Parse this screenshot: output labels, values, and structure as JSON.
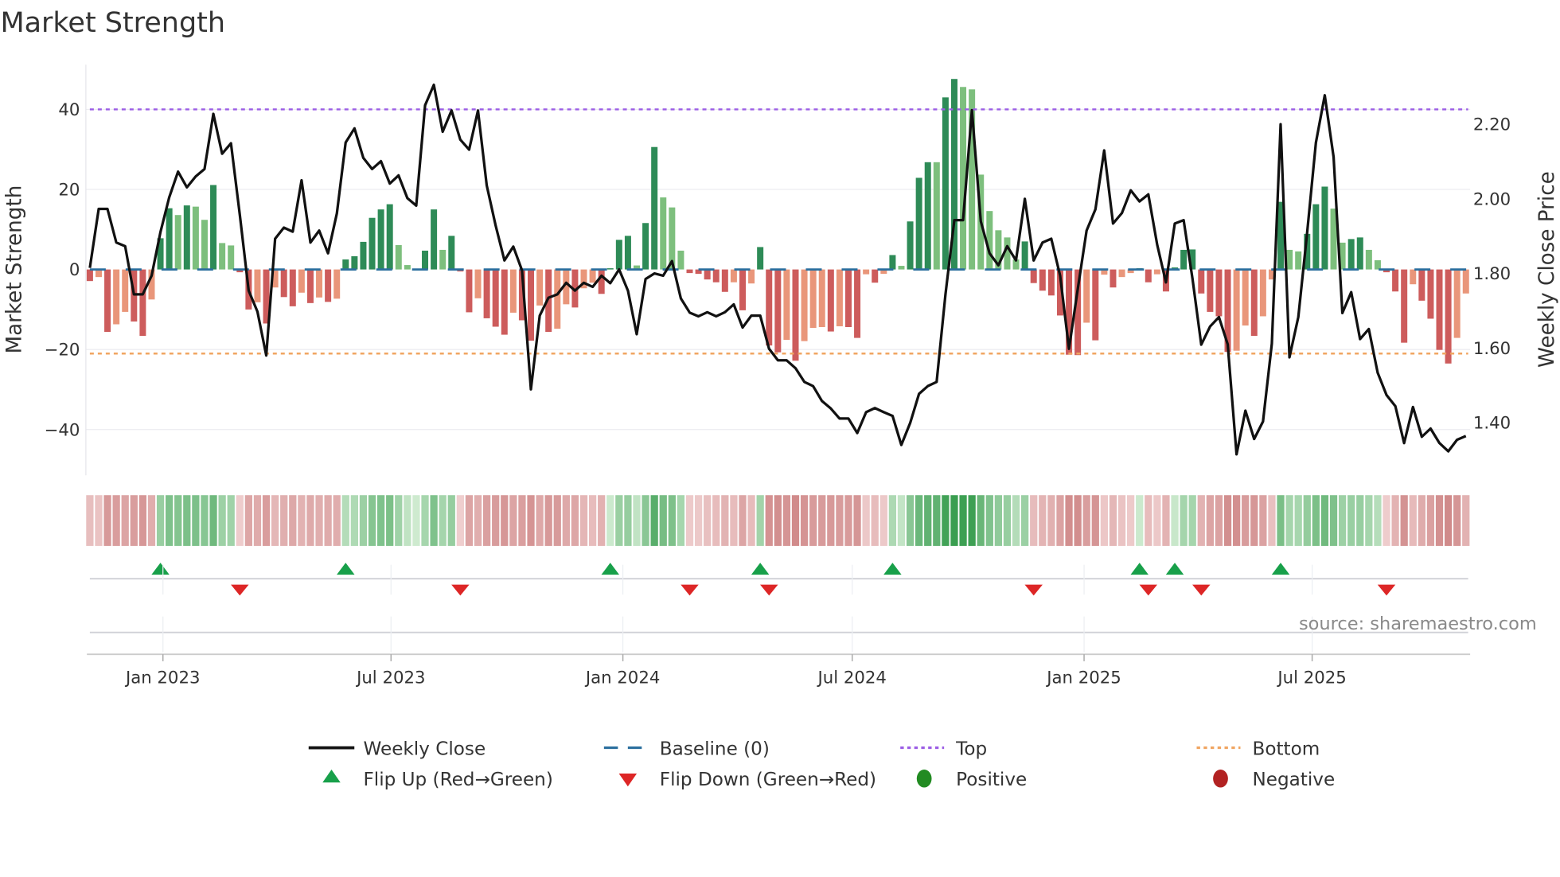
{
  "title": "Market Strength",
  "source": "source: sharemaestro.com",
  "colors": {
    "pos_strong": "#2e8b57",
    "pos_weak": "#7dbf7d",
    "neg_strong": "#cd5c5c",
    "neg_weak": "#e9967a",
    "close_line": "#111111",
    "baseline": "#2b6f9e",
    "top": "#9b5de5",
    "bottom": "#f0a561",
    "flip_up": "#18a04a",
    "flip_down": "#dd2626",
    "positive": "#228b22",
    "negative": "#b22222"
  },
  "legend": {
    "weekly_close": "Weekly Close",
    "baseline": "Baseline (0)",
    "top": "Top",
    "bottom": "Bottom",
    "flip_up": "Flip Up (Red→Green)",
    "flip_down": "Flip Down (Green→Red)",
    "positive": "Positive",
    "negative": "Negative"
  },
  "chart_data": {
    "type": "bar",
    "title": "Market Strength",
    "ylabel": "Market Strength",
    "y2label": "Weekly Close Price",
    "ylim": [
      -52,
      50
    ],
    "y2lim": [
      1.27,
      2.38
    ],
    "yticks": [
      40,
      20,
      0,
      -20,
      -40
    ],
    "ytick_labels": [
      "40",
      "20",
      "0",
      "−20",
      "−40"
    ],
    "y2ticks": [
      2.2,
      2.0,
      1.8,
      1.6,
      1.4
    ],
    "y2tick_labels": [
      "2.20",
      "2.00",
      "1.80",
      "1.60",
      "1.40"
    ],
    "top_level": 40,
    "bottom_level": -21,
    "baseline": 0,
    "x_start": "2022-11-04",
    "x_step_days": 7,
    "xticks": [
      "2023-01-01",
      "2023-07-01",
      "2024-01-01",
      "2024-07-01",
      "2025-01-01",
      "2025-07-01"
    ],
    "xtick_labels": [
      "Jan 2023",
      "Jul 2023",
      "Jan 2024",
      "Jul 2024",
      "Jan 2025",
      "Jul 2025"
    ],
    "grid": true,
    "legend_position": "bottom",
    "series": [
      {
        "name": "Market Strength",
        "type": "bar",
        "values": [
          -2.9,
          -1.9,
          -15.6,
          -13.7,
          -10.6,
          -13,
          -16.6,
          -7.5,
          7.8,
          15.3,
          13.6,
          16,
          15.7,
          12.4,
          21.1,
          6.6,
          6,
          -0.7,
          -10,
          -8.2,
          -13.5,
          -4.5,
          -6.9,
          -9.2,
          -5.8,
          -8.4,
          -7,
          -8.1,
          -7.3,
          2.5,
          3.3,
          6.9,
          12.9,
          15,
          16.3,
          6.1,
          1.1,
          0.2,
          4.7,
          15,
          4.9,
          8.4,
          -0.5,
          -10.7,
          -7.2,
          -12.2,
          -14.3,
          -16.3,
          -10.8,
          -12.7,
          -17.8,
          -9,
          -15.6,
          -14.8,
          -8.7,
          -9.5,
          -4.7,
          -3.3,
          -6.1,
          0.3,
          7.4,
          8.4,
          1,
          11.6,
          30.6,
          18,
          15.5,
          4.7,
          -0.9,
          -1.1,
          -2.5,
          -3.2,
          -5.6,
          -3.2,
          -10.2,
          -3.5,
          5.6,
          -19,
          -20.7,
          -17.6,
          -22.8,
          -17.9,
          -14.6,
          -14.4,
          -15.5,
          -14.2,
          -14.4,
          -17.1,
          -1.2,
          -3.3,
          -1.1,
          3.6,
          0.9,
          12,
          22.9,
          26.8,
          26.8,
          43,
          47.6,
          45.6,
          45,
          23.7,
          14.6,
          9.8,
          8,
          2.5,
          7,
          -3.4,
          -5.3,
          -6.5,
          -11.5,
          -21.3,
          -21.4,
          -13.3,
          -17.7,
          -1.3,
          -4.5,
          -1.9,
          -0.9,
          0.3,
          -3.2,
          -1.2,
          -5.5,
          0.5,
          4.9,
          5.0,
          -6,
          -10.6,
          -11.7,
          -20.6,
          -20.3,
          -14,
          -16.6,
          -11.7,
          -2.5,
          16.9,
          4.9,
          4.5,
          8.9,
          16.3,
          20.7,
          15.2,
          6.7,
          7.6,
          8,
          4.9,
          2.3,
          -0.7,
          -5.5,
          -18.3,
          -3.7,
          -7.8,
          -12.3,
          -20.1,
          -23.5,
          -17.1,
          -6
        ]
      },
      {
        "name": "Weekly Close",
        "type": "line",
        "axis": "right",
        "values": [
          1.815,
          1.973,
          1.973,
          1.883,
          1.873,
          1.744,
          1.744,
          1.794,
          1.911,
          2.004,
          2.073,
          2.031,
          2.06,
          2.08,
          2.228,
          2.121,
          2.149,
          1.957,
          1.754,
          1.698,
          1.58,
          1.893,
          1.923,
          1.912,
          2.05,
          1.883,
          1.915,
          1.854,
          1.961,
          2.151,
          2.189,
          2.11,
          2.08,
          2.101,
          2.041,
          2.063,
          2.002,
          1.982,
          2.251,
          2.306,
          2.18,
          2.237,
          2.159,
          2.132,
          2.237,
          2.036,
          1.929,
          1.835,
          1.872,
          1.808,
          1.489,
          1.687,
          1.735,
          1.744,
          1.775,
          1.754,
          1.775,
          1.764,
          1.794,
          1.774,
          1.811,
          1.754,
          1.637,
          1.785,
          1.8,
          1.794,
          1.833,
          1.733,
          1.695,
          1.685,
          1.696,
          1.685,
          1.696,
          1.717,
          1.655,
          1.687,
          1.687,
          1.598,
          1.567,
          1.567,
          1.546,
          1.509,
          1.498,
          1.458,
          1.438,
          1.411,
          1.411,
          1.372,
          1.428,
          1.439,
          1.428,
          1.418,
          1.34,
          1.399,
          1.477,
          1.498,
          1.509,
          1.744,
          1.943,
          1.943,
          2.238,
          1.94,
          1.854,
          1.822,
          1.873,
          1.835,
          2.0,
          1.835,
          1.883,
          1.893,
          1.794,
          1.598,
          1.758,
          1.915,
          1.972,
          2.13,
          1.934,
          1.962,
          2.023,
          1.993,
          2.012,
          1.877,
          1.776,
          1.934,
          1.943,
          1.786,
          1.609,
          1.658,
          1.683,
          1.61,
          1.315,
          1.432,
          1.356,
          1.403,
          1.612,
          2.2,
          1.575,
          1.683,
          1.91,
          2.151,
          2.278,
          2.112,
          1.694,
          1.75,
          1.624,
          1.651,
          1.534,
          1.474,
          1.444,
          1.345,
          1.442,
          1.362,
          1.384,
          1.345,
          1.323,
          1.354,
          1.364
        ]
      }
    ]
  }
}
